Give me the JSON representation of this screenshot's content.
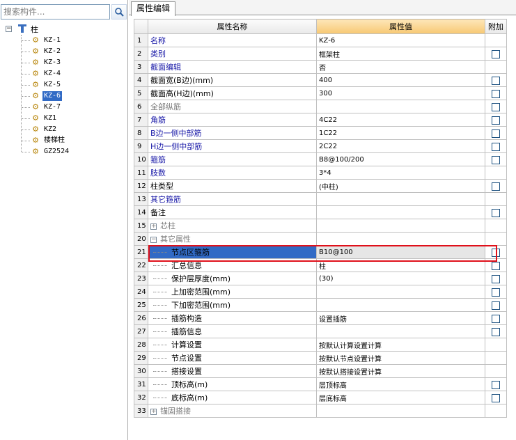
{
  "left": {
    "search_placeholder": "搜索构件...",
    "tree_root": "柱",
    "tree_items": [
      "KZ-1",
      "KZ-2",
      "KZ-3",
      "KZ-4",
      "KZ-5",
      "KZ-6",
      "KZ-7",
      "KZ1",
      "KZ2",
      "楼梯柱",
      "GZ2524"
    ],
    "selected": "KZ-6"
  },
  "right": {
    "tab_label": "属性编辑",
    "headers": {
      "name": "属性名称",
      "value": "属性值",
      "attach": "附加"
    },
    "rows": [
      {
        "num": "1",
        "name": "名称",
        "value": "KZ-6",
        "cb": false,
        "style": "blue"
      },
      {
        "num": "2",
        "name": "类别",
        "value": "框架柱",
        "cb": true,
        "style": "blue"
      },
      {
        "num": "3",
        "name": "截面编辑",
        "value": "否",
        "cb": false,
        "style": "blue"
      },
      {
        "num": "4",
        "name": "截面宽(B边)(mm)",
        "value": "400",
        "cb": true,
        "style": "black"
      },
      {
        "num": "5",
        "name": "截面高(H边)(mm)",
        "value": "300",
        "cb": true,
        "style": "black"
      },
      {
        "num": "6",
        "name": "全部纵筋",
        "value": "",
        "cb": true,
        "style": "gray"
      },
      {
        "num": "7",
        "name": "角筋",
        "value": "4C22",
        "cb": true,
        "style": "blue"
      },
      {
        "num": "8",
        "name": "B边一侧中部筋",
        "value": "1C22",
        "cb": true,
        "style": "blue"
      },
      {
        "num": "9",
        "name": "H边一侧中部筋",
        "value": "2C22",
        "cb": true,
        "style": "blue"
      },
      {
        "num": "10",
        "name": "箍筋",
        "value": "B8@100/200",
        "cb": true,
        "style": "blue"
      },
      {
        "num": "11",
        "name": "肢数",
        "value": "3*4",
        "cb": false,
        "style": "blue"
      },
      {
        "num": "12",
        "name": "柱类型",
        "value": "(中柱)",
        "cb": true,
        "style": "black"
      },
      {
        "num": "13",
        "name": "其它箍筋",
        "value": "",
        "cb": false,
        "style": "blue"
      },
      {
        "num": "14",
        "name": "备注",
        "value": "",
        "cb": true,
        "style": "black"
      },
      {
        "num": "15",
        "name": "芯柱",
        "value": "",
        "cb": false,
        "style": "gray",
        "expander": "+"
      },
      {
        "num": "20",
        "name": "其它属性",
        "value": "",
        "cb": false,
        "style": "gray",
        "expander": "−"
      },
      {
        "num": "21",
        "name": "节点区箍筋",
        "value": "B10@100",
        "cb": true,
        "style": "child",
        "highlight": true
      },
      {
        "num": "22",
        "name": "汇总信息",
        "value": "柱",
        "cb": true,
        "style": "child"
      },
      {
        "num": "23",
        "name": "保护层厚度(mm)",
        "value": "(30)",
        "cb": true,
        "style": "child"
      },
      {
        "num": "24",
        "name": "上加密范围(mm)",
        "value": "",
        "cb": true,
        "style": "child"
      },
      {
        "num": "25",
        "name": "下加密范围(mm)",
        "value": "",
        "cb": true,
        "style": "child"
      },
      {
        "num": "26",
        "name": "插筋构造",
        "value": "设置插筋",
        "cb": true,
        "style": "child"
      },
      {
        "num": "27",
        "name": "插筋信息",
        "value": "",
        "cb": true,
        "style": "child"
      },
      {
        "num": "28",
        "name": "计算设置",
        "value": "按默认计算设置计算",
        "cb": false,
        "style": "child"
      },
      {
        "num": "29",
        "name": "节点设置",
        "value": "按默认节点设置计算",
        "cb": false,
        "style": "child"
      },
      {
        "num": "30",
        "name": "搭接设置",
        "value": "按默认搭接设置计算",
        "cb": false,
        "style": "child"
      },
      {
        "num": "31",
        "name": "顶标高(m)",
        "value": "层顶标高",
        "cb": true,
        "style": "child"
      },
      {
        "num": "32",
        "name": "底标高(m)",
        "value": "层底标高",
        "cb": true,
        "style": "child"
      },
      {
        "num": "33",
        "name": "锚固搭接",
        "value": "",
        "cb": false,
        "style": "gray",
        "expander": "+"
      }
    ]
  },
  "colors": {
    "highlight_border": "#e0101a",
    "selection": "#316ac5",
    "header_accent": "#f7c873"
  }
}
